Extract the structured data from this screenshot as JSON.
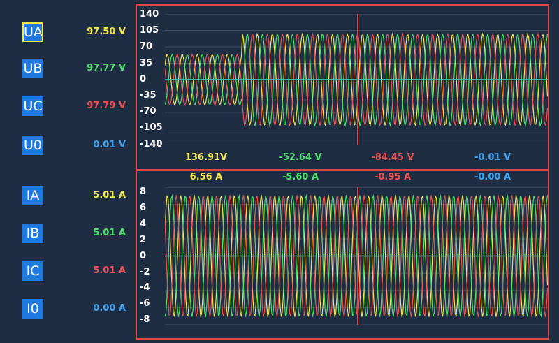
{
  "colors": {
    "background": "#1f2d43",
    "phase_a": "#f3e54a",
    "phase_b": "#4ae068",
    "phase_c": "#ec5050",
    "zero": "#3aa3f5",
    "zero_line": "#3fe0d0",
    "cursor": "#e0474b",
    "button": "#1e79e0",
    "selected_border": "#f3e840"
  },
  "channels": [
    {
      "label": "UA",
      "value": "97.50  V",
      "selected": true
    },
    {
      "label": "UB",
      "value": "97.77  V",
      "selected": false
    },
    {
      "label": "UC",
      "value": "97.79  V",
      "selected": false
    },
    {
      "label": "U0",
      "value": "0.01  V",
      "selected": false
    },
    {
      "label": "IA",
      "value": "5.01  A",
      "selected": false
    },
    {
      "label": "IB",
      "value": "5.01  A",
      "selected": false
    },
    {
      "label": "IC",
      "value": "5.01  A",
      "selected": false
    },
    {
      "label": "I0",
      "value": "0.00  A",
      "selected": false
    }
  ],
  "voltage_ticks": [
    "140",
    "105",
    "70",
    "35",
    "0",
    "-35",
    "-70",
    "-105",
    "-140"
  ],
  "current_ticks": [
    "8",
    "6",
    "4",
    "2",
    "0",
    "-2",
    "-4",
    "-6",
    "-8"
  ],
  "voltage_readings": [
    "136.91V",
    "-52.64 V",
    "-84.45 V",
    "-0.01 V"
  ],
  "current_readings": [
    "6.56 A",
    "-5.60 A",
    "-0.95 A",
    "-0.00 A"
  ],
  "chart_data": [
    {
      "type": "line",
      "ylim": [
        -140,
        140
      ],
      "series": [
        {
          "name": "UA",
          "amplitude": 97.5
        },
        {
          "name": "UB",
          "amplitude": 97.77
        },
        {
          "name": "UC",
          "amplitude": 97.79
        },
        {
          "name": "U0",
          "amplitude": 0.01
        }
      ]
    },
    {
      "type": "line",
      "ylim": [
        -8,
        8
      ],
      "series": [
        {
          "name": "IA",
          "amplitude": 7.08
        },
        {
          "name": "IB",
          "amplitude": 7.08
        },
        {
          "name": "IC",
          "amplitude": 7.08
        },
        {
          "name": "I0",
          "amplitude": 0.0
        }
      ]
    }
  ]
}
